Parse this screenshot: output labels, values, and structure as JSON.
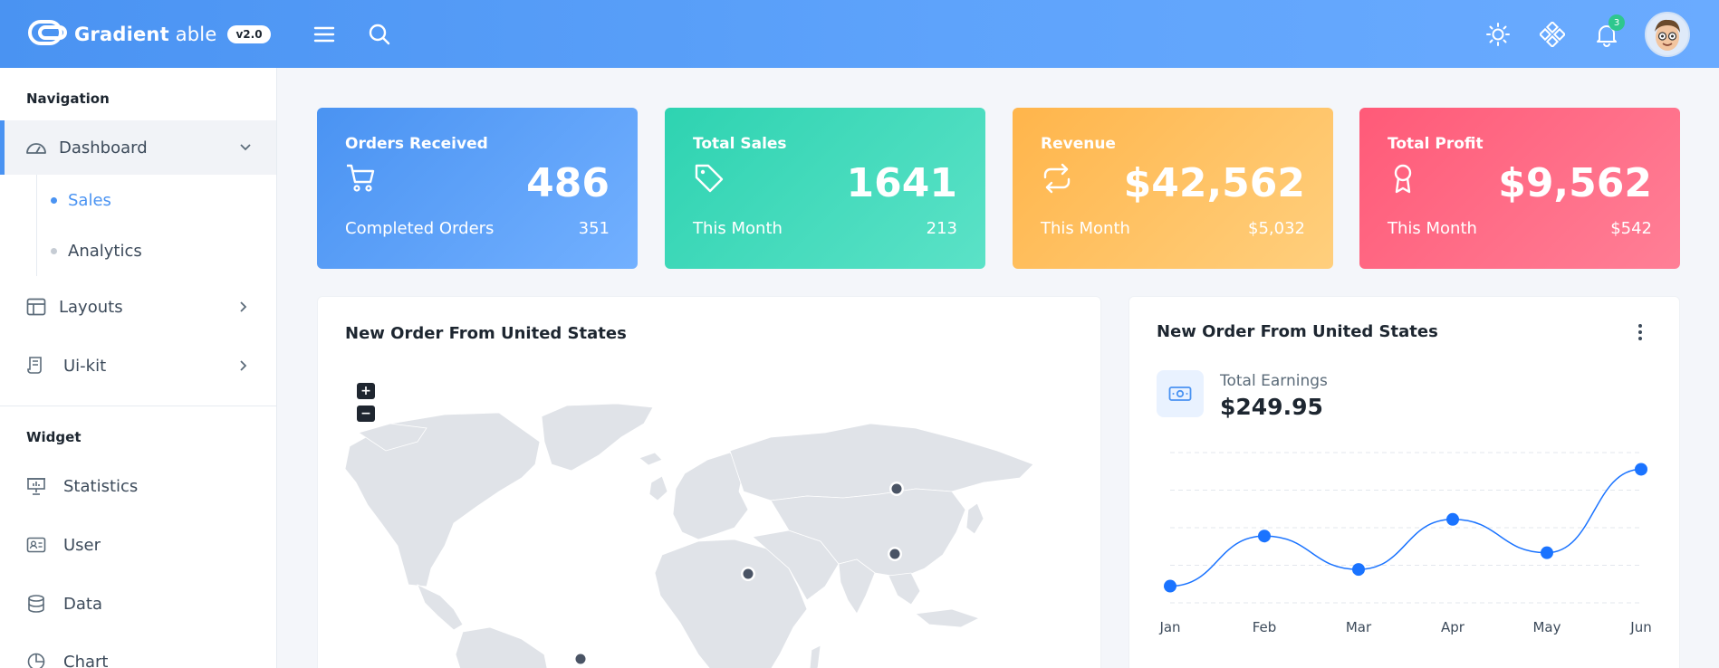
{
  "header": {
    "logo_bold": "Gradient",
    "logo_light": " able",
    "version": "v2.0",
    "notifications_count": "3",
    "icons": [
      "menu-icon",
      "search-icon",
      "sun-icon",
      "settings-diamond-icon",
      "bell-icon"
    ]
  },
  "sidebar": {
    "navigation_caption": "Navigation",
    "widget_caption": "Widget",
    "items": [
      {
        "label": "Dashboard",
        "icon": "dashboard-gauge-icon",
        "expanded": true
      },
      {
        "label": "Layouts",
        "icon": "layout-icon"
      },
      {
        "label": "Ui-kit",
        "icon": "ui-kit-icon"
      },
      {
        "label": "Statistics",
        "icon": "presentation-icon"
      },
      {
        "label": "User",
        "icon": "user-card-icon"
      },
      {
        "label": "Data",
        "icon": "database-icon"
      },
      {
        "label": "Chart",
        "icon": "pie-chart-icon"
      }
    ],
    "subitems": [
      {
        "label": "Sales",
        "active": true
      },
      {
        "label": "Analytics",
        "active": false
      }
    ]
  },
  "stats": [
    {
      "title": "Orders Received",
      "value": "486",
      "sub_label": "Completed Orders",
      "sub_value": "351",
      "icon": "cart-icon",
      "color": "#4a93f2"
    },
    {
      "title": "Total Sales",
      "value": "1641",
      "sub_label": "This Month",
      "sub_value": "213",
      "icon": "tag-icon",
      "color": "#2ed3b1"
    },
    {
      "title": "Revenue",
      "value": "$42,562",
      "sub_label": "This Month",
      "sub_value": "$5,032",
      "icon": "repeat-icon",
      "color": "#ffb54b"
    },
    {
      "title": "Total Profit",
      "value": "$9,562",
      "sub_label": "This Month",
      "sub_value": "$542",
      "icon": "award-icon",
      "color": "#ff5a78"
    }
  ],
  "map_panel": {
    "title": "New Order From United States",
    "zoom_in": "+",
    "zoom_out": "−"
  },
  "earnings_panel": {
    "title": "New Order From United States",
    "earnings_label": "Total Earnings",
    "earnings_value": "$249.95"
  },
  "chart_data": {
    "type": "line",
    "categories": [
      "Jan",
      "Feb",
      "Mar",
      "Apr",
      "May",
      "Jun"
    ],
    "series": [
      {
        "values": [
          30,
          60,
          40,
          70,
          50,
          100
        ]
      }
    ],
    "ylim": [
      20,
      110
    ],
    "grid": true,
    "color": "#1a73ff"
  }
}
